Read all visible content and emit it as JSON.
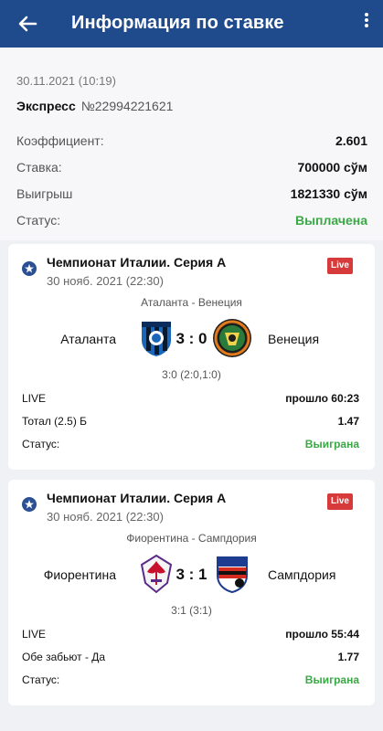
{
  "header": {
    "title": "Информация по ставке"
  },
  "summary": {
    "date": "30.11.2021 (10:19)",
    "express_label": "Экспресс",
    "express_number": "№22994221621",
    "rows": [
      {
        "label": "Коэффициент:",
        "value": "2.601"
      },
      {
        "label": "Ставка:",
        "value": "700000 сўм"
      },
      {
        "label": "Выигрыш",
        "value": "1821330 сўм"
      },
      {
        "label": "Статус:",
        "value": "Выплачена"
      }
    ]
  },
  "events": [
    {
      "league": "Чемпионат Италии. Серия А",
      "date": "30 нояб. 2021 (22:30)",
      "live_badge": "Live",
      "pair": "Аталанта - Венеция",
      "home": "Аталанта",
      "away": "Венеция",
      "score": "3 : 0",
      "detail": "3:0 (2:0,1:0)",
      "state_label": "LIVE",
      "state_value": "прошло 60:23",
      "bet_label": "Тотал (2.5) Б",
      "bet_value": "1.47",
      "status_label": "Статус:",
      "status_value": "Выиграна"
    },
    {
      "league": "Чемпионат Италии. Серия А",
      "date": "30 нояб. 2021 (22:30)",
      "live_badge": "Live",
      "pair": "Фиорентина - Сампдория",
      "home": "Фиорентина",
      "away": "Сампдория",
      "score": "3 : 1",
      "detail": "3:1 (3:1)",
      "state_label": "LIVE",
      "state_value": "прошло 55:44",
      "bet_label": "Обе забьют - Да",
      "bet_value": "1.77",
      "status_label": "Статус:",
      "status_value": "Выиграна"
    }
  ],
  "colors": {
    "header": "#1f4b8c",
    "win": "#3aa845",
    "live": "#d63a3a"
  },
  "icons": [
    "back-arrow-icon",
    "more-vert-icon",
    "league-icon",
    "team-logo"
  ]
}
